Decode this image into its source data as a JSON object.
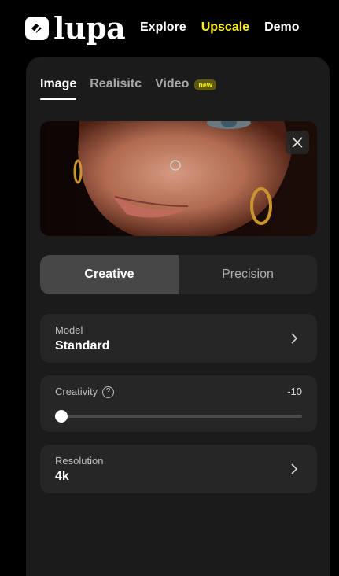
{
  "brand": {
    "name": "lupa"
  },
  "nav": {
    "items": [
      {
        "label": "Explore",
        "active": false
      },
      {
        "label": "Upscale",
        "active": true
      },
      {
        "label": "Demo",
        "active": false
      }
    ],
    "accent_color": "#fff200"
  },
  "tabs": [
    {
      "label": "Image",
      "active": true
    },
    {
      "label": "Realisitc",
      "active": false
    },
    {
      "label": "Video",
      "active": false,
      "badge": "new"
    }
  ],
  "preview": {
    "close_icon": "close-icon"
  },
  "mode": {
    "options": [
      {
        "label": "Creative",
        "selected": true
      },
      {
        "label": "Precision",
        "selected": false
      }
    ]
  },
  "model": {
    "label": "Model",
    "value": "Standard"
  },
  "creativity": {
    "label": "Creativity",
    "value": "-10",
    "level_fraction": 0.0
  },
  "resolution": {
    "label": "Resolution",
    "value": "4k"
  },
  "colors": {
    "panel": "#1b1b1b",
    "card": "#262626",
    "background": "#000000"
  }
}
